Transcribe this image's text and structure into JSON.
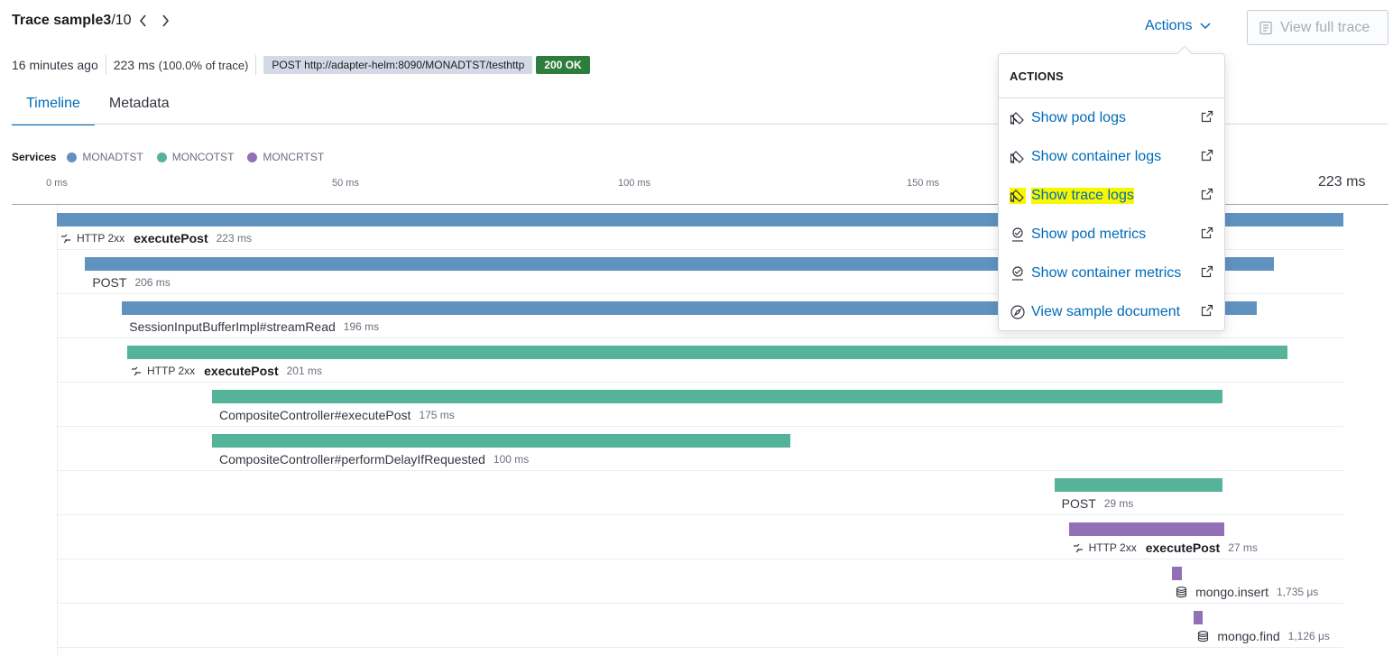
{
  "header": {
    "title_prefix": "Trace sample ",
    "title_index": "3",
    "title_total": "/10",
    "time_ago": "16 minutes ago",
    "duration": "223 ms",
    "duration_pct": "(100.0% of trace)",
    "url_badge": "POST http://adapter-helm:8090/MONADTST/testhttp",
    "status_badge": "200 OK",
    "actions_label": "Actions",
    "view_full_trace_label": "View full trace"
  },
  "tabs": [
    {
      "label": "Timeline",
      "active": true
    },
    {
      "label": "Metadata",
      "active": false
    }
  ],
  "legend": {
    "label": "Services",
    "services": [
      {
        "name": "MONADTST",
        "color": "#6092c0"
      },
      {
        "name": "MONCOTST",
        "color": "#54b399"
      },
      {
        "name": "MONCRTST",
        "color": "#9170b8"
      }
    ]
  },
  "axis": {
    "ticks": [
      "0 ms",
      "50 ms",
      "100 ms",
      "150 ms"
    ],
    "max_label": "223 ms"
  },
  "spans": [
    {
      "service": 0,
      "start_ms": 0,
      "duration_ms": 223,
      "http": "HTTP 2xx",
      "name": "executePost",
      "bold": true,
      "duration": "223 ms",
      "icon": "exit-icon"
    },
    {
      "service": 0,
      "start_ms": 4.9,
      "duration_ms": 206,
      "http": "",
      "name": "POST",
      "bold": false,
      "duration": "206 ms",
      "icon": ""
    },
    {
      "service": 0,
      "start_ms": 11.3,
      "duration_ms": 196.7,
      "http": "",
      "name": "SessionInputBufferImpl#streamRead",
      "bold": false,
      "duration": "196 ms",
      "icon": ""
    },
    {
      "service": 1,
      "start_ms": 12.2,
      "duration_ms": 201.1,
      "http": "HTTP 2xx",
      "name": "executePost",
      "bold": true,
      "duration": "201 ms",
      "icon": "exit-icon"
    },
    {
      "service": 1,
      "start_ms": 26.9,
      "duration_ms": 175.1,
      "http": "",
      "name": "CompositeController#executePost",
      "bold": false,
      "duration": "175 ms",
      "icon": ""
    },
    {
      "service": 1,
      "start_ms": 26.9,
      "duration_ms": 100.2,
      "http": "",
      "name": "CompositeController#performDelayIfRequested",
      "bold": false,
      "duration": "100 ms",
      "icon": ""
    },
    {
      "service": 1,
      "start_ms": 172.9,
      "duration_ms": 29.1,
      "http": "",
      "name": "POST",
      "bold": false,
      "duration": "29 ms",
      "icon": ""
    },
    {
      "service": 2,
      "start_ms": 175.4,
      "duration_ms": 26.9,
      "http": "HTTP 2xx",
      "name": "executePost",
      "bold": true,
      "duration": "27 ms",
      "icon": "exit-icon"
    },
    {
      "service": 2,
      "start_ms": 193.3,
      "duration_ms": 1.735,
      "http": "",
      "name": "mongo.insert",
      "bold": false,
      "duration": "1,735 μs",
      "icon": "database-icon"
    },
    {
      "service": 2,
      "start_ms": 197.1,
      "duration_ms": 1.126,
      "http": "",
      "name": "mongo.find",
      "bold": false,
      "duration": "1,126 μs",
      "icon": "database-icon"
    }
  ],
  "actions_menu": {
    "title": "ACTIONS",
    "items": [
      {
        "label": "Show pod logs",
        "icon": "logs-icon",
        "highlighted": false
      },
      {
        "label": "Show container logs",
        "icon": "logs-icon",
        "highlighted": false
      },
      {
        "label": "Show trace logs",
        "icon": "logs-icon",
        "highlighted": true
      },
      {
        "label": "Show pod metrics",
        "icon": "metrics-icon",
        "highlighted": false
      },
      {
        "label": "Show container metrics",
        "icon": "metrics-icon",
        "highlighted": false
      },
      {
        "label": "View sample document",
        "icon": "compass-icon",
        "highlighted": false
      }
    ]
  }
}
